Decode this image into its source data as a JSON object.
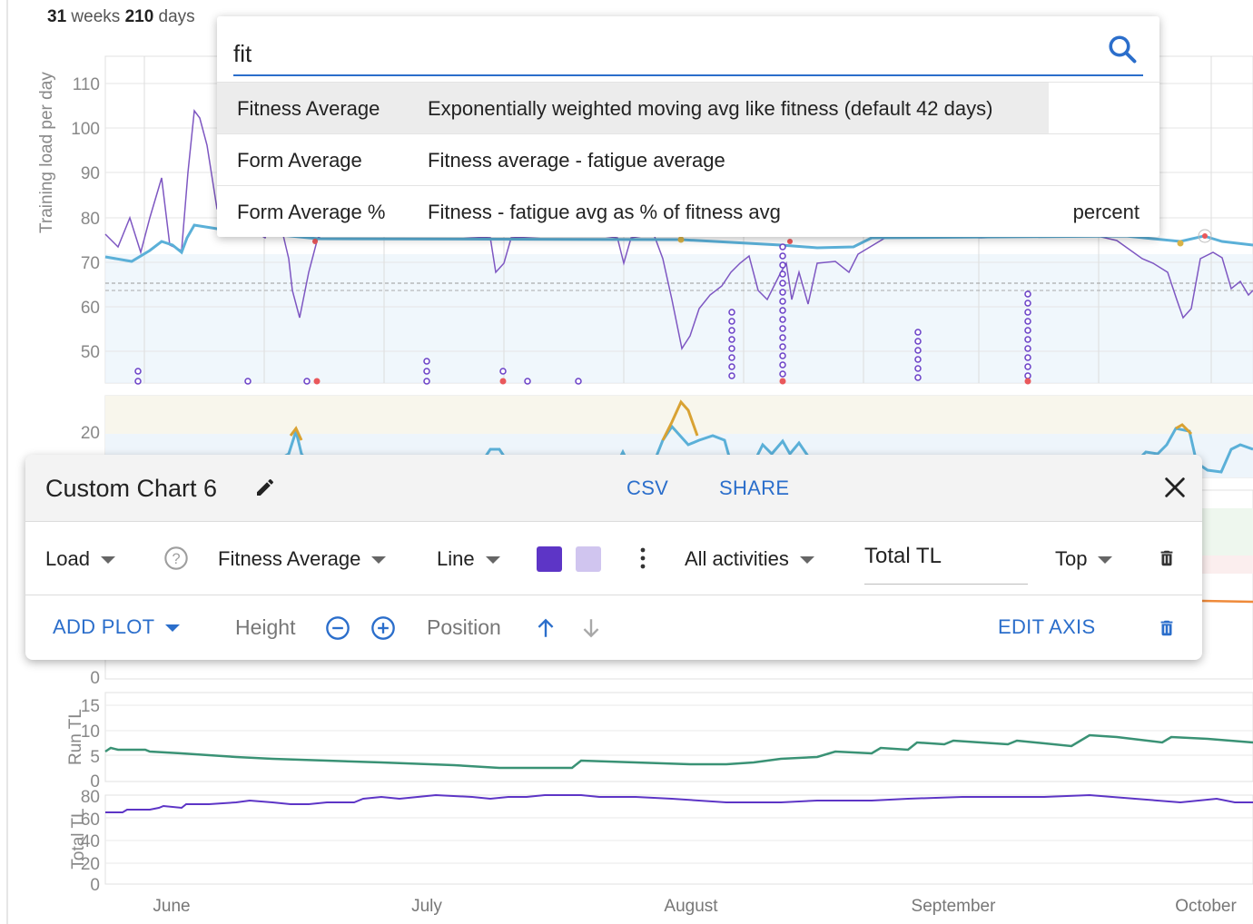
{
  "summary": {
    "weeks_value": "31",
    "weeks_unit": "weeks",
    "days_value": "210",
    "days_unit": "days"
  },
  "search": {
    "query": "fit",
    "options": [
      {
        "name": "Fitness Average",
        "description": "Exponentially weighted moving avg like fitness (default 42 days)",
        "unit": ""
      },
      {
        "name": "Form Average",
        "description": "Fitness average - fatigue average",
        "unit": ""
      },
      {
        "name": "Form Average %",
        "description": "Fitness - fatigue avg as % of fitness avg",
        "unit": "percent"
      }
    ]
  },
  "card": {
    "title": "Custom Chart 6",
    "csv_label": "CSV",
    "share_label": "SHARE",
    "plot": {
      "source": "Load",
      "metric": "Fitness Average",
      "chart_type": "Line",
      "primary_color": "#5d35c6",
      "secondary_color": "#d0c5ef",
      "activities": "All activities",
      "axis_label_value": "Total TL",
      "position": "Top"
    },
    "add_plot_label": "ADD PLOT",
    "height_label": "Height",
    "position_label": "Position",
    "edit_axis_label": "EDIT AXIS"
  },
  "charts": {
    "top": {
      "ylabel": "Training load per day",
      "ticks": [
        "110",
        "100",
        "90",
        "80",
        "70",
        "60",
        "50"
      ]
    },
    "second": {
      "ticks": [
        "20"
      ]
    },
    "third": {
      "ticks": [
        "0"
      ]
    },
    "run": {
      "ylabel": "Run TL",
      "ticks": [
        "15",
        "10",
        "5",
        "0"
      ]
    },
    "total": {
      "ylabel": "Total TL",
      "ticks": [
        "80",
        "60",
        "40",
        "20",
        "0"
      ]
    },
    "months": [
      "June",
      "July",
      "August",
      "September",
      "October"
    ]
  },
  "colors": {
    "accent": "#2b6ecb",
    "fitness": "#5bb0d8",
    "load": "#7e57c2",
    "run": "#3a9275",
    "total": "#5d35c6",
    "form_hot": "#d9a233"
  }
}
